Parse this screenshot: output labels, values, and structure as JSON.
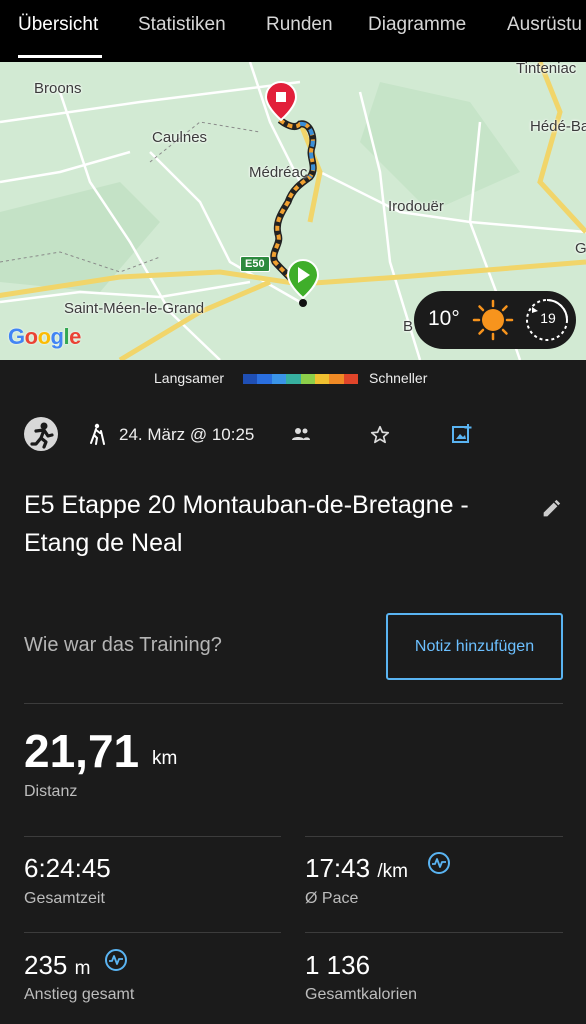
{
  "tabs": [
    {
      "label": "Übersicht",
      "active": true
    },
    {
      "label": "Statistiken",
      "active": false
    },
    {
      "label": "Runden",
      "active": false
    },
    {
      "label": "Diagramme",
      "active": false
    },
    {
      "label": "Ausrüstu",
      "active": false
    }
  ],
  "map": {
    "places": [
      "Broons",
      "Caulnes",
      "Médréac",
      "Irodouër",
      "Saint-Méen-le-Grand",
      "Tinteniac",
      "Hédé-Ba",
      "G",
      "B"
    ],
    "road_label": "E50",
    "attribution": "Google"
  },
  "weather": {
    "temperature": "10°",
    "condition_icon": "sun-icon",
    "wind_value": "19"
  },
  "legend": {
    "slow_label": "Langsamer",
    "fast_label": "Schneller",
    "colors": [
      "#1f4fb5",
      "#2a6fe0",
      "#3a94e8",
      "#37b0a0",
      "#8ccf4a",
      "#f0c030",
      "#f08a25",
      "#e0452a"
    ]
  },
  "activity": {
    "type_icon": "hiking-icon",
    "date": "24. März @ 10:25",
    "title": "E5 Etappe 20 Montauban-de-Bretagne - Etang de Neal"
  },
  "notes": {
    "question": "Wie war das Training?",
    "button_label": "Notiz hinzufügen"
  },
  "stats": {
    "distance": {
      "value": "21,71",
      "unit": "km",
      "label": "Distanz"
    },
    "total_time": {
      "value": "6:24:45",
      "label": "Gesamtzeit"
    },
    "pace": {
      "value": "17:43",
      "unit": "/km",
      "label": "Ø Pace"
    },
    "ascent": {
      "value": "235",
      "unit": "m",
      "label": "Anstieg gesamt"
    },
    "calories": {
      "value": "1 136",
      "label": "Gesamtkalorien"
    }
  },
  "colors": {
    "accent": "#5ab4f2",
    "start_pin": "#3fae2a",
    "end_pin": "#e21f3a",
    "background": "#1b1b1b"
  }
}
